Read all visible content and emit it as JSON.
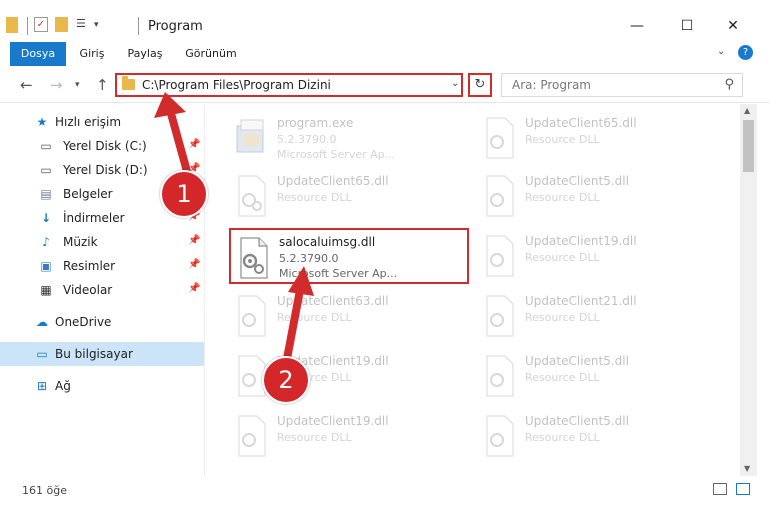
{
  "window": {
    "title": "Program"
  },
  "ribbon": {
    "tabs": [
      "Dosya",
      "Giriş",
      "Paylaş",
      "Görünüm"
    ]
  },
  "address": {
    "path": "C:\\Program Files\\Program Dizini"
  },
  "search": {
    "placeholder": "Ara: Program"
  },
  "sidebar": {
    "quick_access": "Hızlı erişim",
    "items": [
      {
        "label": "Yerel Disk (C:)",
        "icon": "drive-icon"
      },
      {
        "label": "Yerel Disk (D:)",
        "icon": "drive-icon"
      },
      {
        "label": "Belgeler",
        "icon": "documents-icon"
      },
      {
        "label": "İndirmeler",
        "icon": "downloads-icon"
      },
      {
        "label": "Müzik",
        "icon": "music-icon"
      },
      {
        "label": "Resimler",
        "icon": "pictures-icon"
      },
      {
        "label": "Videolar",
        "icon": "videos-icon"
      }
    ],
    "onedrive": "OneDrive",
    "this_pc": "Bu bilgisayar",
    "network": "Ağ"
  },
  "files": {
    "left": [
      {
        "name": "program.exe",
        "sub1": "5.2.3790.0",
        "sub2": "Microsoft Server Ap...",
        "dim": true
      },
      {
        "name": "UpdateClient65.dll",
        "sub1": "Resource DLL",
        "dim": true
      },
      {
        "name": "salocaluimsg.dll",
        "sub1": "5.2.3790.0",
        "sub2": "Microsoft Server Ap...",
        "dim": false
      },
      {
        "name": "UpdateClient63.dll",
        "sub1": "Resource DLL",
        "dim": true
      },
      {
        "name": "UpdateClient19.dll",
        "sub1": "Resource DLL",
        "dim": true
      },
      {
        "name": "UpdateClient19.dll",
        "sub1": "Resource DLL",
        "dim": true
      }
    ],
    "right": [
      {
        "name": "UpdateClient65.dll",
        "sub1": "Resource DLL",
        "dim": true
      },
      {
        "name": "UpdateClient5.dll",
        "sub1": "Resource DLL",
        "dim": true
      },
      {
        "name": "UpdateClient19.dll",
        "sub1": "Resource DLL",
        "dim": true
      },
      {
        "name": "UpdateClient21.dll",
        "sub1": "Resource DLL",
        "dim": true
      },
      {
        "name": "UpdateClient5.dll",
        "sub1": "Resource DLL",
        "dim": true
      },
      {
        "name": "UpdateClient5.dll",
        "sub1": "Resource DLL",
        "dim": true
      }
    ]
  },
  "status": {
    "count": "161 öğe"
  },
  "annotations": {
    "badge1": "1",
    "badge2": "2",
    "accent": "#d22b2b"
  }
}
